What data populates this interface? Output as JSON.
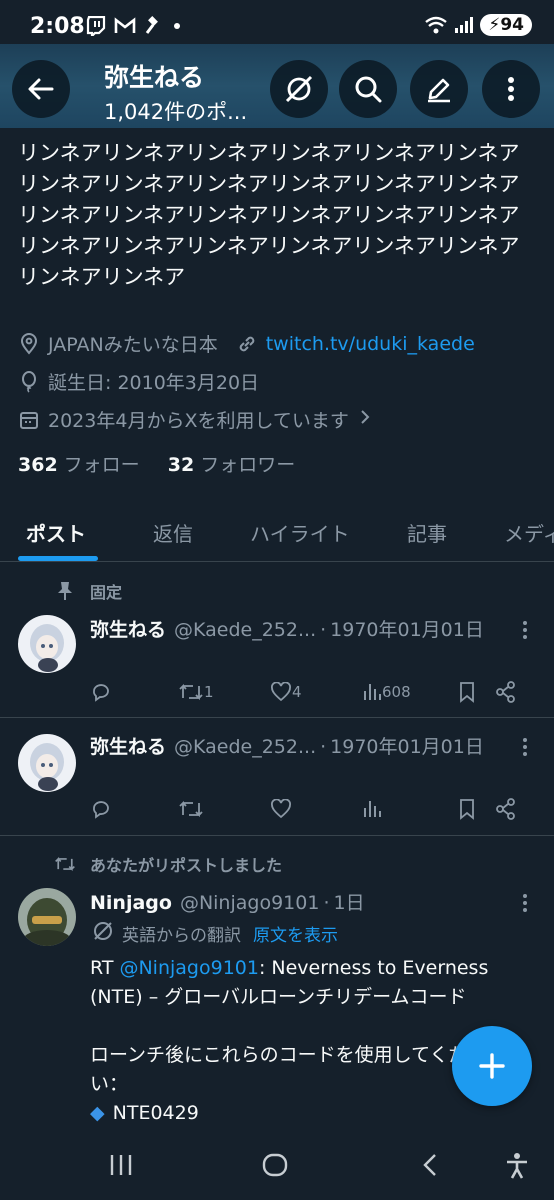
{
  "status_bar": {
    "time": "2:08",
    "left_icons": [
      "twitch-icon",
      "gmail-icon",
      "gavel-icon",
      "dot-icon"
    ],
    "battery": "94"
  },
  "header": {
    "title": "弥生ねる",
    "subtitle": "1,042件のポ..."
  },
  "profile": {
    "bio": "リンネアリンネアリンネアリンネアリンネアリンネアリンネアリンネアリンネアリンネアリンネアリンネアリンネアリンネアリンネアリンネアリンネアリンネアリンネアリンネアリンネアリンネアリンネアリンネアリンネアリンネア",
    "location": "JAPANみたいな日本",
    "link": "twitch.tv/uduki_kaede",
    "birthday": "誕生日: 2010年3月20日",
    "joined": "2023年4月からXを利用しています",
    "following_count": "362",
    "following_label": "フォロー",
    "followers_count": "32",
    "followers_label": "フォロワー"
  },
  "tabs": [
    "ポスト",
    "返信",
    "ハイライト",
    "記事",
    "メディア"
  ],
  "posts": [
    {
      "context": "固定",
      "name": "弥生ねる",
      "handle": "@Kaede_252...",
      "date": "1970年01月01日",
      "replies": "",
      "reposts": "1",
      "likes": "4",
      "views": "608"
    },
    {
      "context": "",
      "name": "弥生ねる",
      "handle": "@Kaede_252...",
      "date": "1970年01月01日",
      "replies": "",
      "reposts": "",
      "likes": "",
      "views": ""
    },
    {
      "context": "あなたがリポストしました",
      "name": "Ninjago",
      "handle": "@Ninjago9101",
      "date": "1日",
      "translation_note": "英語からの翻訳",
      "show_original": "原文を表示",
      "text_prefix": "RT ",
      "mention": "@Ninjago9101",
      "text_line1_rest": ": Neverness to Everness",
      "text_line2": "(NTE) – グローバルローンチリデームコード",
      "text_line3": "ローンチ後にこれらのコードを使用してくださ",
      "text_line4": "い：",
      "code": "NTE0429"
    }
  ],
  "colors": {
    "background": "#15202b",
    "accent": "#1d9bf0",
    "muted": "#8b98a5",
    "divider": "#38444d"
  }
}
